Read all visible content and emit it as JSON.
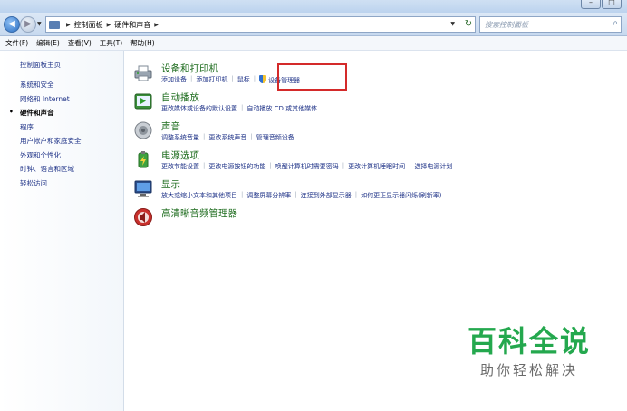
{
  "address": {
    "crumbs": [
      "控制面板",
      "硬件和声音"
    ],
    "search_placeholder": "搜索控制面板"
  },
  "menu": [
    "文件(F)",
    "编辑(E)",
    "查看(V)",
    "工具(T)",
    "帮助(H)"
  ],
  "sidebar": {
    "home": "控制面板主页",
    "items": [
      {
        "label": "系统和安全"
      },
      {
        "label": "网络和 Internet"
      },
      {
        "label": "硬件和声音"
      },
      {
        "label": "程序"
      },
      {
        "label": "用户帐户和家庭安全"
      },
      {
        "label": "外观和个性化"
      },
      {
        "label": "时钟、语言和区域"
      },
      {
        "label": "轻松访问"
      }
    ]
  },
  "categories": [
    {
      "title": "设备和打印机",
      "links": [
        "添加设备",
        "添加打印机",
        "鼠标",
        "设备管理器"
      ]
    },
    {
      "title": "自动播放",
      "links": [
        "更改媒体或设备的默认设置",
        "自动播放 CD 或其他媒体"
      ]
    },
    {
      "title": "声音",
      "links": [
        "调整系统音量",
        "更改系统声音",
        "管理音频设备"
      ]
    },
    {
      "title": "电源选项",
      "links": [
        "更改节能设置",
        "更改电源按钮的功能",
        "唤醒计算机时需要密码",
        "更改计算机睡眠时间",
        "选择电源计划"
      ]
    },
    {
      "title": "显示",
      "links": [
        "放大或缩小文本和其他项目",
        "调整屏幕分辨率",
        "连接到外部显示器",
        "如何更正显示器闪烁(刷新率)"
      ]
    },
    {
      "title": "高清晰音频管理器",
      "links": []
    }
  ],
  "watermark": {
    "title": "百科全说",
    "subtitle": "助你轻松解决"
  }
}
